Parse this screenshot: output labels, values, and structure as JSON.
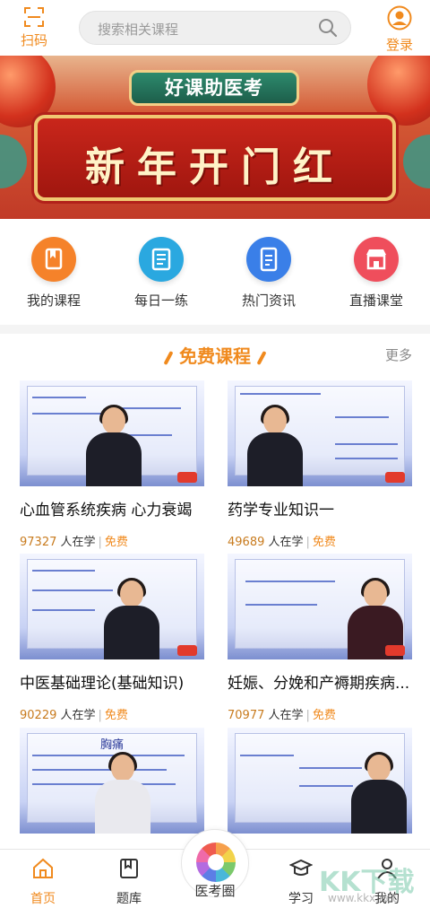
{
  "topbar": {
    "scan_label": "扫码",
    "search_placeholder": "搜索相关课程",
    "login_label": "登录"
  },
  "banner": {
    "tag_text": "好课助医考",
    "headline": "新年开门红",
    "slide_count": 3,
    "active_slide": 1
  },
  "quick_links": [
    {
      "label": "我的课程",
      "icon": "book-icon",
      "color": "#f5822a"
    },
    {
      "label": "每日一练",
      "icon": "notebook-icon",
      "color": "#2aa8e0"
    },
    {
      "label": "热门资讯",
      "icon": "document-icon",
      "color": "#3a7fe8"
    },
    {
      "label": "直播课堂",
      "icon": "shop-icon",
      "color": "#ef4e5c"
    }
  ],
  "free_courses": {
    "title": "免费课程",
    "more_label": "更多",
    "learning_suffix": "人在学",
    "free_label": "免费",
    "items": [
      {
        "title": "心血管系统疾病  心力衰竭",
        "learners": "97327"
      },
      {
        "title": "药学专业知识一",
        "learners": "49689"
      },
      {
        "title": "中医基础理论(基础知识)",
        "learners": "90229"
      },
      {
        "title": "妊娠、分娩和产褥期疾病...",
        "learners": "70977"
      },
      {
        "title": "",
        "learners": ""
      },
      {
        "title": "",
        "learners": ""
      }
    ],
    "thumb_texts": [
      "胸痛"
    ]
  },
  "bottom_nav": {
    "items": [
      {
        "label": "首页",
        "icon": "home-icon",
        "active": true
      },
      {
        "label": "题库",
        "icon": "question-bank-icon",
        "active": false
      },
      {
        "label": "医考圈",
        "icon": "aperture-icon",
        "active": false
      },
      {
        "label": "学习",
        "icon": "graduation-cap-icon",
        "active": false
      },
      {
        "label": "我的",
        "icon": "user-icon",
        "active": false
      }
    ]
  },
  "watermark": {
    "big": "KK下载",
    "small": "www.kkx.net"
  },
  "colors": {
    "accent": "#f08a1e",
    "active_nav": "#f08a1e"
  }
}
